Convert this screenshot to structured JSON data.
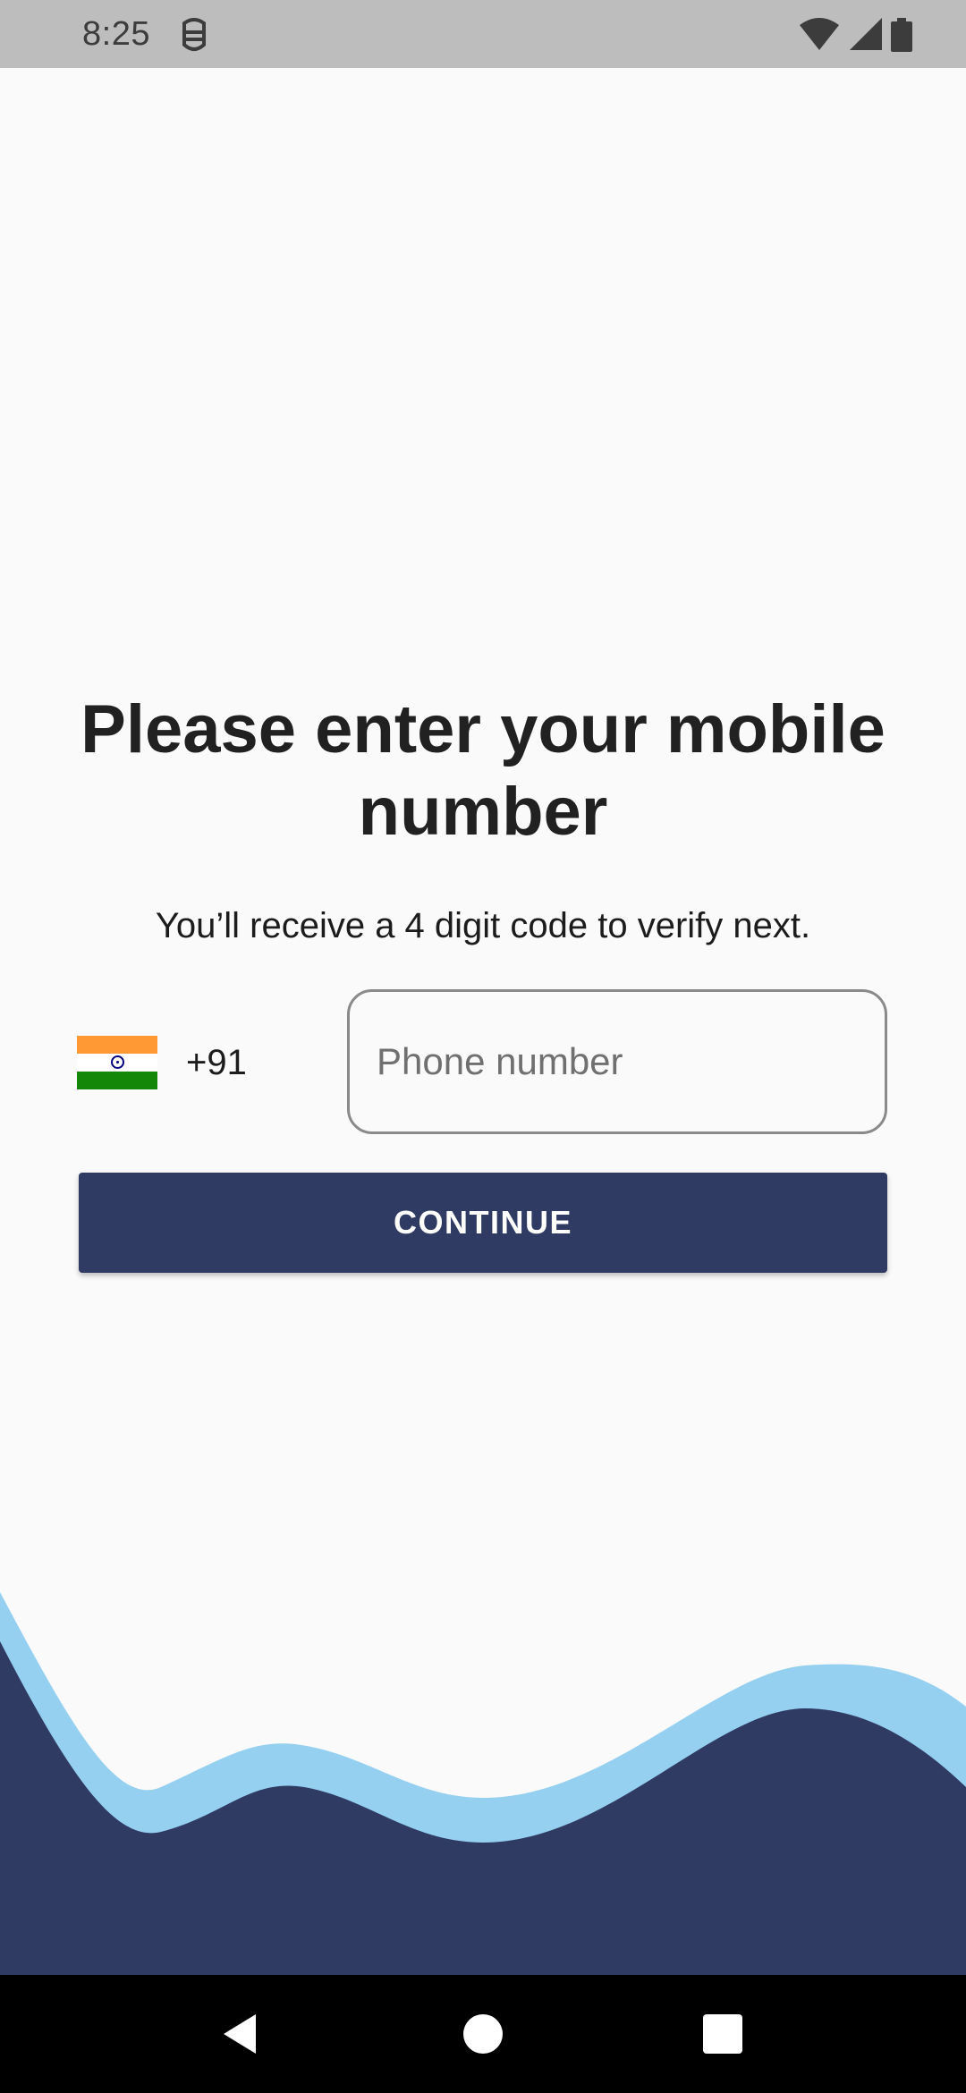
{
  "status_bar": {
    "time": "8:25",
    "icons": [
      "debug-icon",
      "wifi-icon",
      "signal-icon",
      "battery-icon"
    ]
  },
  "login": {
    "title": "Please enter your mobile number",
    "subtitle": "You’ll receive a 4 digit code to verify next.",
    "country": {
      "flag": "india-flag-icon",
      "dial_code": "+91"
    },
    "phone_input": {
      "placeholder": "Phone number",
      "value": ""
    },
    "continue_label": "CONTINUE"
  },
  "colors": {
    "background": "#fafafa",
    "primary": "#2f3b63",
    "wave_light": "#96d0f1",
    "wave_dark": "#2f3b63"
  },
  "nav_bar": {
    "buttons": [
      "back-icon",
      "home-icon",
      "recents-icon"
    ]
  }
}
